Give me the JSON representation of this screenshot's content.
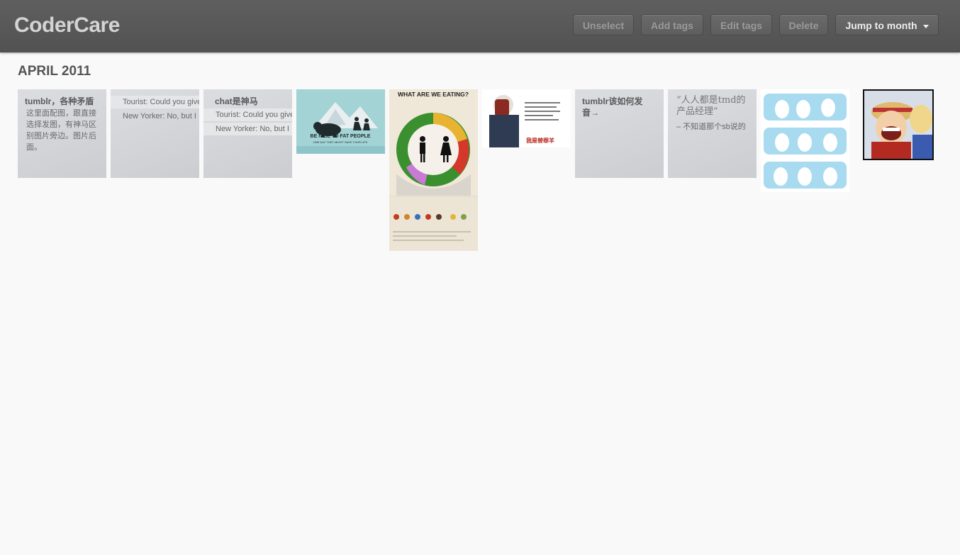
{
  "header": {
    "brand": "CoderCare",
    "buttons": {
      "unselect": "Unselect",
      "add_tags": "Add tags",
      "edit_tags": "Edit tags",
      "delete": "Delete",
      "jump_to_month": "Jump to month"
    }
  },
  "month": {
    "title": "APRIL 2011"
  },
  "posts": {
    "p1": {
      "title": "tumblr，各种矛盾",
      "body": "这里面配图，跟直接选择发图，有神马区别图片旁边。图片后面。"
    },
    "p2": {
      "line1": "Tourist: Could you give",
      "line2": "New Yorker: No, but I"
    },
    "p3": {
      "title": "chat是神马",
      "line1": "Tourist: Could you give",
      "line2": "New Yorker: No, but I"
    },
    "p4": {
      "caption": "BE NICE TO FAT PEOPLE",
      "subcaption": "ONE DAY THEY MIGHT SAVE YOUR LIFE"
    },
    "p5": {
      "title": "WHAT ARE WE EATING?"
    },
    "p6": {
      "caption": "我是替罪羊"
    },
    "p7": {
      "title": "tumblr该如何发音→"
    },
    "p8": {
      "quote": "“人人都是tmd的产品经理”",
      "source": "– 不知道那个sb说的"
    },
    "p9": {},
    "p10": {}
  },
  "colors": {
    "topbar": "#585858",
    "page_bg": "#f9f9f9",
    "tile_bg": "#d3d5d8"
  }
}
